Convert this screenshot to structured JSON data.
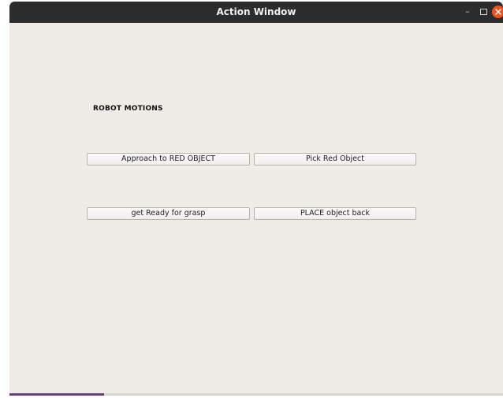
{
  "window": {
    "title": "Action Window",
    "minimize_symbol": "–",
    "colors": {
      "titlebar": "#2c2c2c",
      "background": "#efebe7",
      "close_button": "#e95420"
    }
  },
  "section": {
    "label": "ROBOT MOTIONS"
  },
  "buttons": {
    "approach_red": "Approach to RED OBJECT",
    "pick_red": "Pick Red Object",
    "ready_grasp": "get Ready for grasp",
    "place_back": "PLACE object back"
  },
  "icons": {
    "minimize": "minimize-icon",
    "maximize": "maximize-icon",
    "close": "close-icon"
  }
}
